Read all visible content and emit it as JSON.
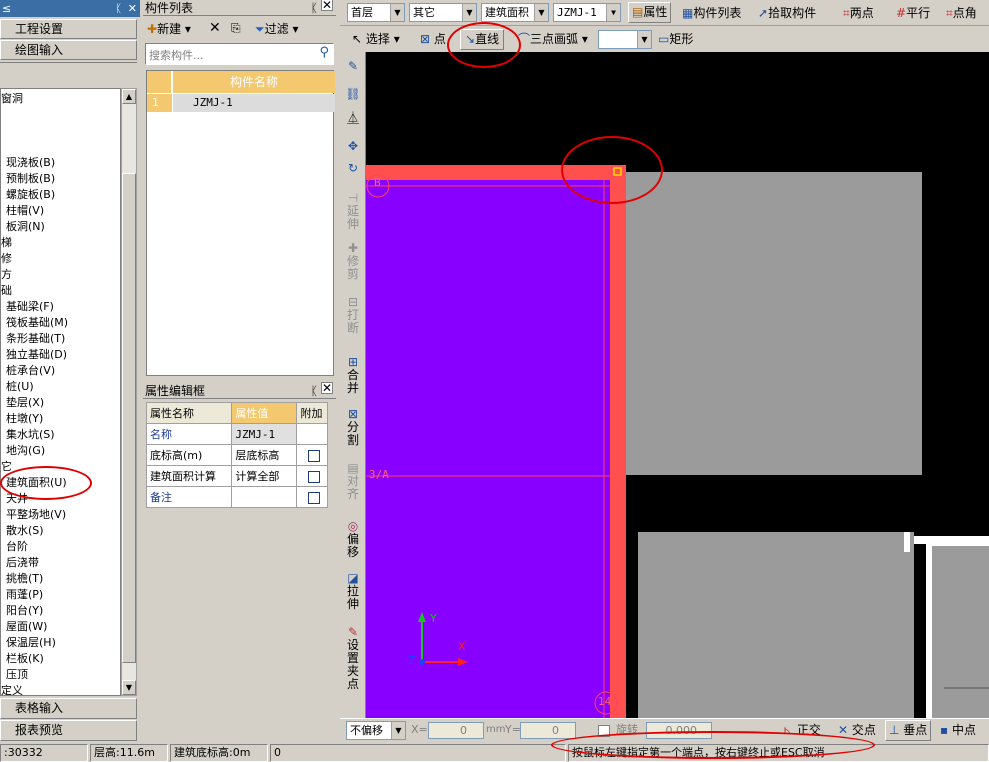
{
  "left_panel": {
    "header_title": "≤",
    "nav": [
      "工程设置",
      "绘图输入"
    ],
    "tree_items": [
      "窗洞",
      "",
      "",
      "",
      "现浇板(B)",
      "预制板(B)",
      "螺旋板(B)",
      "柱帽(V)",
      "板洞(N)",
      "梯",
      "修",
      "方",
      "础",
      "基础梁(F)",
      "筏板基础(M)",
      "条形基础(T)",
      "独立基础(D)",
      "桩承台(V)",
      "桩(U)",
      "垫层(X)",
      "柱墩(Y)",
      "集水坑(S)",
      "地沟(G)",
      "它",
      "建筑面积(U)",
      "天井",
      "平整场地(V)",
      "散水(S)",
      "台阶",
      "后浇带",
      "挑檐(T)",
      "雨蓬(P)",
      "阳台(Y)",
      "屋面(W)",
      "保温层(H)",
      "栏板(K)",
      "压顶",
      "定义"
    ],
    "bottom_nav": [
      "表格输入",
      "报表预览"
    ]
  },
  "component_list": {
    "title": "构件列表",
    "new_label": "新建",
    "filter_label": "过滤",
    "search_placeholder": "搜索构件...",
    "column_header": "构件名称",
    "rows": [
      {
        "index": "1",
        "name": "JZMJ-1"
      }
    ]
  },
  "property_panel": {
    "title": "属性编辑框",
    "headers": [
      "属性名称",
      "属性值",
      "附加"
    ],
    "rows": [
      {
        "name": "名称",
        "value": "JZMJ-1",
        "has_checkbox": false
      },
      {
        "name": "底标高(m)",
        "value": "层底标高",
        "has_checkbox": true
      },
      {
        "name": "建筑面积计算",
        "value": "计算全部",
        "has_checkbox": true
      },
      {
        "name": "备注",
        "value": "",
        "has_checkbox": true
      }
    ]
  },
  "toolbar_top": {
    "floor": "首层",
    "category": "其它",
    "type": "建筑面积",
    "component": "JZMJ-1",
    "attribute_label": "属性",
    "comp_list_label": "构件列表",
    "pick_label": "拾取构件",
    "two_point_label": "两点",
    "parallel_label": "平行",
    "point_angle_label": "点角"
  },
  "toolbar_draw": {
    "select_label": "选择",
    "point_label": "点",
    "line_label": "直线",
    "arc_label": "三点画弧",
    "rect_label": "矩形"
  },
  "vertical_tools": [
    "延伸",
    "修剪",
    "打断",
    "合并",
    "分割",
    "对齐",
    "偏移",
    "拉伸",
    "设置夹点"
  ],
  "canvas": {
    "axis_b": "B",
    "axis_3a": "3/A",
    "axis_14": "14",
    "ucs_y": "Y",
    "ucs_x": "X",
    "ucs_z": "Z"
  },
  "snap_bar": {
    "offset_mode": "不偏移",
    "x_label": "X=",
    "x_value": "0",
    "unit_mm": "mm",
    "y_label": "Y=",
    "y_value": "0",
    "rotate_label": "旋转",
    "rotate_value": "0.000",
    "ortho_label": "正交",
    "intersect_label": "交点",
    "perp_label": "垂点",
    "mid_label": "中点"
  },
  "status_bar": {
    "coords": ":30332",
    "floor_height": "层高:11.6m",
    "bottom_elev": "建筑底标高:0m",
    "value": "0",
    "prompt": "按鼠标左键指定第一个端点，按右键终止或ESC取消"
  },
  "colors": {
    "title_blue": "#3a6ea5",
    "canvas_bg": "#000000",
    "purple_area": "#8800ff",
    "red_wall": "#ff5050",
    "gray_block": "#9b9b9b",
    "annotation_red": "#e00000"
  }
}
